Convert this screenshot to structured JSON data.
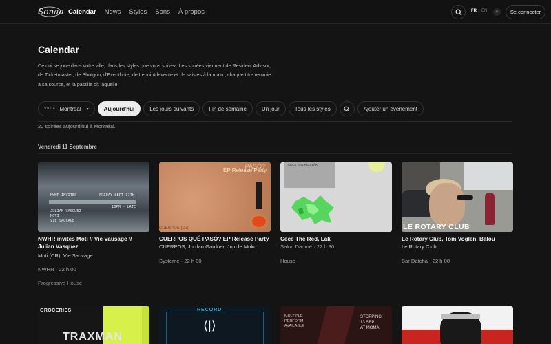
{
  "brand": {
    "logo_text": "Sonaa"
  },
  "nav": {
    "items": [
      {
        "label": "Calendar",
        "active": true
      },
      {
        "label": "News"
      },
      {
        "label": "Styles"
      },
      {
        "label": "Sons"
      },
      {
        "label": "À propos"
      }
    ],
    "lang_fr": "FR",
    "lang_en": "EN",
    "login": "Se connecter"
  },
  "page": {
    "title": "Calendar",
    "intro": "Ce qui se joue dans votre ville, dans les styles que vous suivez. Les soirées viennent de Resident Advisor, de Ticketmaster, de Shotgun, d'Eventbrite, de Lepointdevente et de saisies à la main ; chaque titre renvoie à sa source, et la pastille dit laquelle."
  },
  "filters": {
    "city_label": "VILLE",
    "city_value": "Montréal",
    "chips": [
      "Aujourd'hui",
      "Les jours suivants",
      "Fin de semaine",
      "Un jour",
      "Tous les styles"
    ],
    "active_chip": "Aujourd'hui",
    "add_event": "Ajouter un événement"
  },
  "results": {
    "count_text": "20 soirées aujourd'hui à Montréal.",
    "day_heading": "Vendredi 11 Septembre"
  },
  "events": [
    {
      "title": "NWHR invites Moti // Vie Vausage // Julian Vasquez",
      "artists": "Moti (CR), Vie Sauvage",
      "meta": "NWHR · 22 h 00",
      "tag": "Progressive House",
      "thumb_text": {
        "a": "NWHR INVITES",
        "b": "FRIDAY SEPT 11TH",
        "c": "10PM - LATE",
        "d": "JULIAN VASQUEZ",
        "e": "MOTI",
        "f": "VIE SAUVAGE"
      }
    },
    {
      "title": "CUERPOS QUÉ PASÓ? EP Release Party",
      "artists": "CUERPOS, Jordan Gardner, Juju le Moko",
      "meta": "Système · 22 h 00",
      "tag": "",
      "thumb_text": {
        "a": "PASÓ?",
        "b": "EP Release Party",
        "c": "CUERPOS (DJ)"
      }
    },
    {
      "title": "Cece The Red, Lãk",
      "artists": "Salon Daomé · 22 h 30",
      "meta": "House",
      "tag": "",
      "thumb_text": {
        "a": "CECE THE RED\nLÃK"
      }
    },
    {
      "title": "Le Rotary Club, Tom Voglen, Balou",
      "artists": "Le Rotary Club",
      "meta": "Bar Datcha · 22 h 00",
      "tag": "",
      "thumb_text": {
        "a": "LE ROTARY CLUB"
      }
    }
  ],
  "more_thumbs": {
    "a": {
      "title": "GROCERIES",
      "text": "TRAXMAN"
    },
    "b": {
      "title": "RECORD"
    },
    "c": {
      "left": "MULTIPLE\nPERFORM\nAVAILABLE",
      "right": "STOPPING\n13 SEP\nAT MOMA"
    },
    "d": {}
  },
  "colors": {
    "accent": "#ececec",
    "background": "#141414"
  }
}
